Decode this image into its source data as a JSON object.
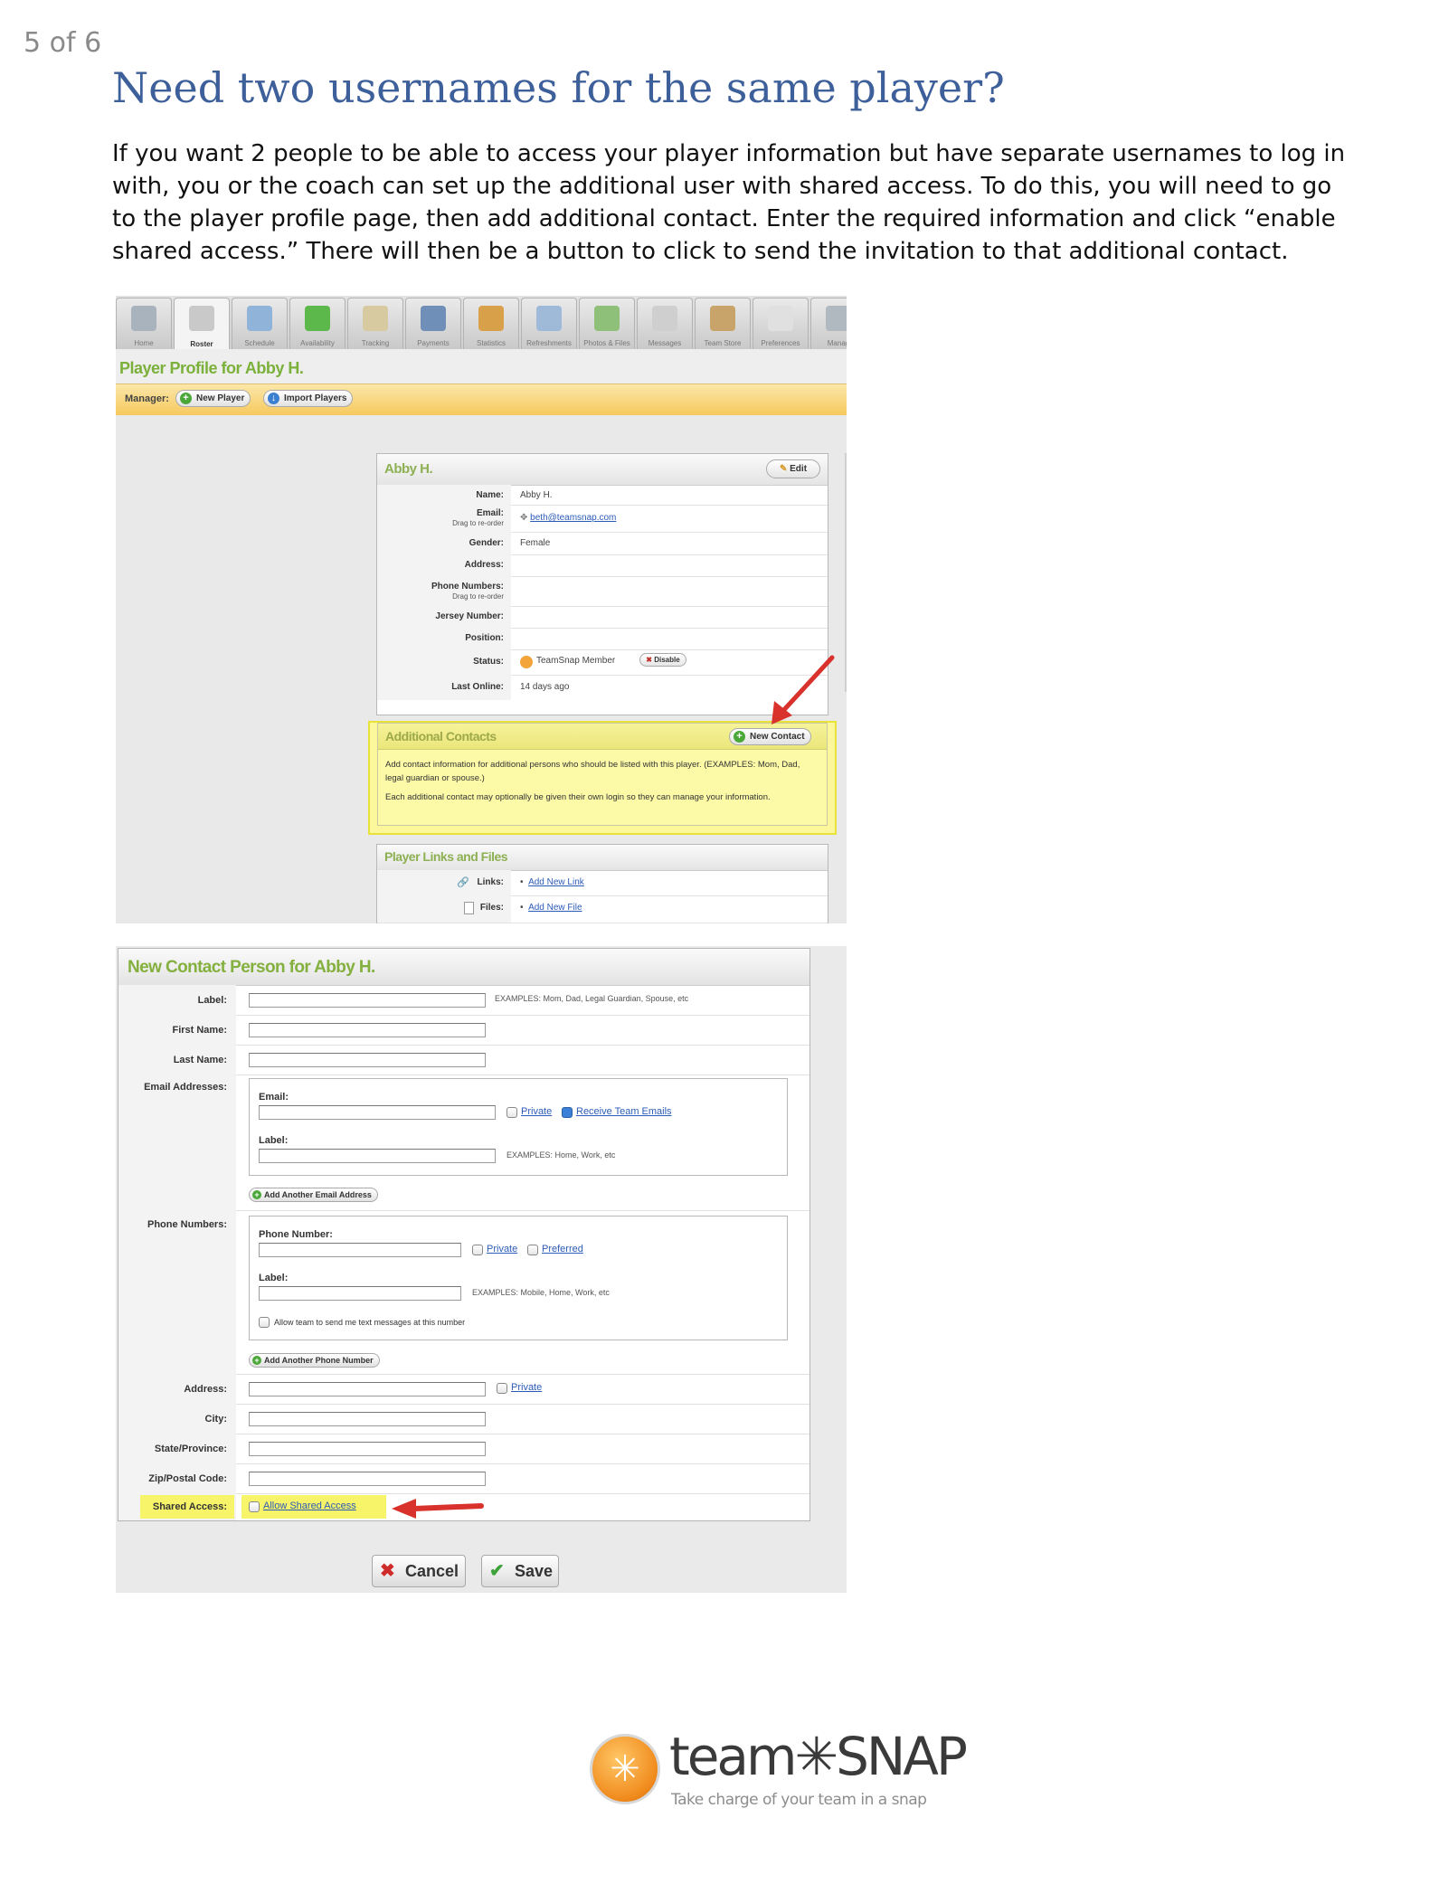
{
  "page_number": "5 of 6",
  "doc_title": "Need two usernames for the same player?",
  "paragraph": "If you want 2 people to be able to access your player information but have separate usernames to log in with, you or the coach can set up the additional user with shared access.  To do this, you will need to go to the player profile page, then add additional contact.  Enter the required information and click “enable shared access.”  There will then be a button to click to send the invitation to that additional contact.",
  "screenshot1": {
    "tabs": [
      {
        "label": "Home",
        "icon": "house-icon"
      },
      {
        "label": "Roster",
        "icon": "roster-icon"
      },
      {
        "label": "Schedule",
        "icon": "calendar-icon"
      },
      {
        "label": "Availability",
        "icon": "check-icon"
      },
      {
        "label": "Tracking",
        "icon": "clipboard-icon"
      },
      {
        "label": "Payments",
        "icon": "card-icon"
      },
      {
        "label": "Statistics",
        "icon": "pie-chart-icon"
      },
      {
        "label": "Refreshments",
        "icon": "cup-icon"
      },
      {
        "label": "Photos & Files",
        "icon": "photo-icon"
      },
      {
        "label": "Messages",
        "icon": "message-icon"
      },
      {
        "label": "Team Store",
        "icon": "bag-icon"
      },
      {
        "label": "Preferences",
        "icon": "switch-icon"
      },
      {
        "label": "Manag",
        "icon": "manager-icon"
      }
    ],
    "active_tab": "Roster",
    "profile_title": "Player Profile for Abby H.",
    "manager_label": "Manager:",
    "new_player_button": "New Player",
    "import_players_button": "Import Players",
    "card_title": "Abby H.",
    "edit_button": "Edit",
    "fields": {
      "name_label": "Name:",
      "name_value": "Abby H.",
      "email_label": "Email:",
      "email_sub": "Drag to re-order",
      "email_value": "beth@teamsnap.com",
      "gender_label": "Gender:",
      "gender_value": "Female",
      "address_label": "Address:",
      "phone_label": "Phone Numbers:",
      "phone_sub": "Drag to re-order",
      "jersey_label": "Jersey Number:",
      "position_label": "Position:",
      "status_label": "Status:",
      "status_value": "TeamSnap Member",
      "disable_button": "Disable",
      "last_online_label": "Last Online:",
      "last_online_value": "14 days ago"
    },
    "additional_contacts": {
      "title": "Additional Contacts",
      "new_contact_button": "New Contact",
      "text1": "Add contact information for additional persons who should be listed with this player. (EXAMPLES: Mom, Dad, legal guardian or spouse.)",
      "text2": "Each additional contact may optionally be given their own login so they can manage your information."
    },
    "links_files": {
      "title": "Player Links and Files",
      "links_label": "Links:",
      "add_link": "Add New Link",
      "files_label": "Files:",
      "add_file": "Add New File"
    }
  },
  "screenshot2": {
    "form_title": "New Contact Person for Abby H.",
    "label_label": "Label:",
    "label_hint": "EXAMPLES: Mom, Dad, Legal Guardian, Spouse, etc",
    "first_name_label": "First Name:",
    "last_name_label": "Last Name:",
    "email_addresses_label": "Email Addresses:",
    "email_label": "Email:",
    "email_private": "Private",
    "receive_team_emails": "Receive Team Emails",
    "email_sub_label": "Label:",
    "email_label_hint": "EXAMPLES: Home, Work, etc",
    "add_email_button": "Add Another Email Address",
    "phone_numbers_label": "Phone Numbers:",
    "phone_number_label": "Phone Number:",
    "phone_private": "Private",
    "phone_preferred": "Preferred",
    "phone_sub_label": "Label:",
    "phone_label_hint": "EXAMPLES: Mobile, Home, Work, etc",
    "allow_text": "Allow team to send me text messages at this number",
    "add_phone_button": "Add Another Phone Number",
    "address_label": "Address:",
    "address_private": "Private",
    "city_label": "City:",
    "state_label": "State/Province:",
    "zip_label": "Zip/Postal Code:",
    "shared_access_label": "Shared Access:",
    "allow_shared_access": "Allow Shared Access",
    "cancel_button": "Cancel",
    "save_button": "Save"
  },
  "logo": {
    "text": "team✳SNAP",
    "tagline": "Take charge of your team in a snap"
  },
  "colors": {
    "title_blue": "#3d5f9a",
    "green_heading": "#84b03f",
    "highlight_yellow": "#f8f46a",
    "arrow_red": "#d9312b",
    "logo_orange": "#f08a1c"
  }
}
